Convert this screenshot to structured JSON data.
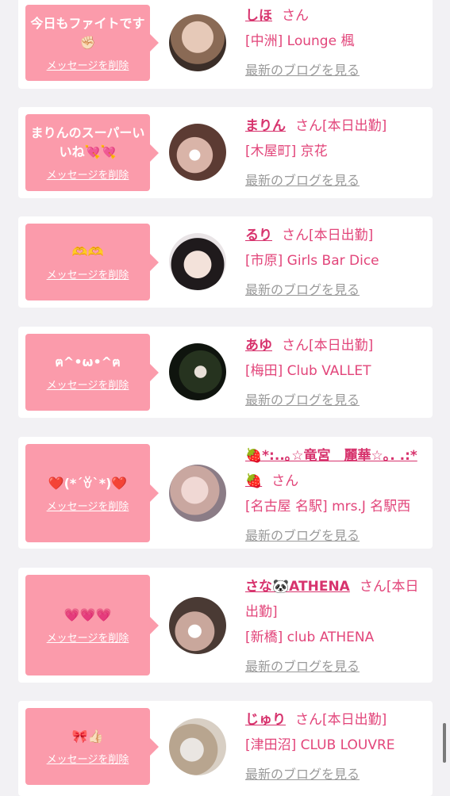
{
  "entries": [
    {
      "message": "今日もファイトです✊🏻",
      "delete_label": "メッセージを削除",
      "name": "しほ",
      "suffix": "さん",
      "shop": "[中洲] Lounge 楓",
      "blog_link": "最新のブログを見る"
    },
    {
      "message": "まりんのスーパーいいね💘💘",
      "delete_label": "メッセージを削除",
      "name": "まりん",
      "suffix": "さん[本日出勤]",
      "shop": "[木屋町] 京花",
      "blog_link": "最新のブログを見る"
    },
    {
      "message": "🫶🫶",
      "delete_label": "メッセージを削除",
      "name": "るり",
      "suffix": "さん[本日出勤]",
      "shop": "[市原] Girls Bar Dice",
      "blog_link": "最新のブログを見る"
    },
    {
      "message": "ฅ^•ω•^ฅ",
      "delete_label": "メッセージを削除",
      "name": "あゆ",
      "suffix": "さん[本日出勤]",
      "shop": "[梅田] Club VALLET",
      "blog_link": "最新のブログを見る"
    },
    {
      "message": "❤️(*´ꈊ`*)❤️",
      "delete_label": "メッセージを削除",
      "name": "🍓*:..｡☆竜宮　麗華☆｡. .:*🍓",
      "suffix": "さん",
      "shop": "[名古屋 名駅] mrs.J 名駅西",
      "blog_link": "最新のブログを見る"
    },
    {
      "message": "💗💗💗",
      "delete_label": "メッセージを削除",
      "name": "さな🐼ATHENA",
      "suffix": "さん[本日出勤]",
      "shop": "[新橋] club ATHENA",
      "blog_link": "最新のブログを見る"
    },
    {
      "message": "🎀👍🏻",
      "delete_label": "メッセージを削除",
      "name": "じゅり",
      "suffix": "さん[本日出勤]",
      "shop": "[津田沼] CLUB LOUVRE",
      "blog_link": "最新のブログを見る"
    }
  ],
  "colors": {
    "accent": "#d7336d",
    "bubble": "#fb9bab",
    "background": "#f2f1f4",
    "muted": "#9a9a9a"
  }
}
